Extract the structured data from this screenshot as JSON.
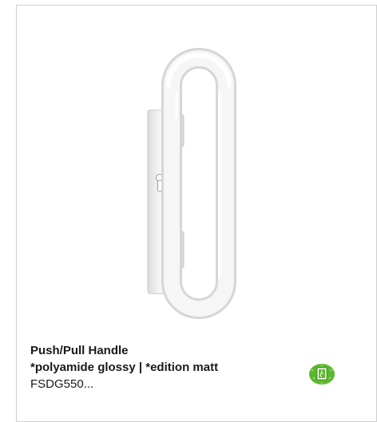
{
  "product": {
    "title": "Push/Pull Handle",
    "subtitle": "*polyamide glossy | *edition matt",
    "code": "FSDG550..."
  },
  "icons": {
    "product_image": "push-pull-handle-image",
    "badge": "emergency-exit-badge-icon"
  },
  "colors": {
    "badge_green": "#5cb82e",
    "badge_dots": "#9be05a",
    "card_border": "#cfcfcf"
  }
}
